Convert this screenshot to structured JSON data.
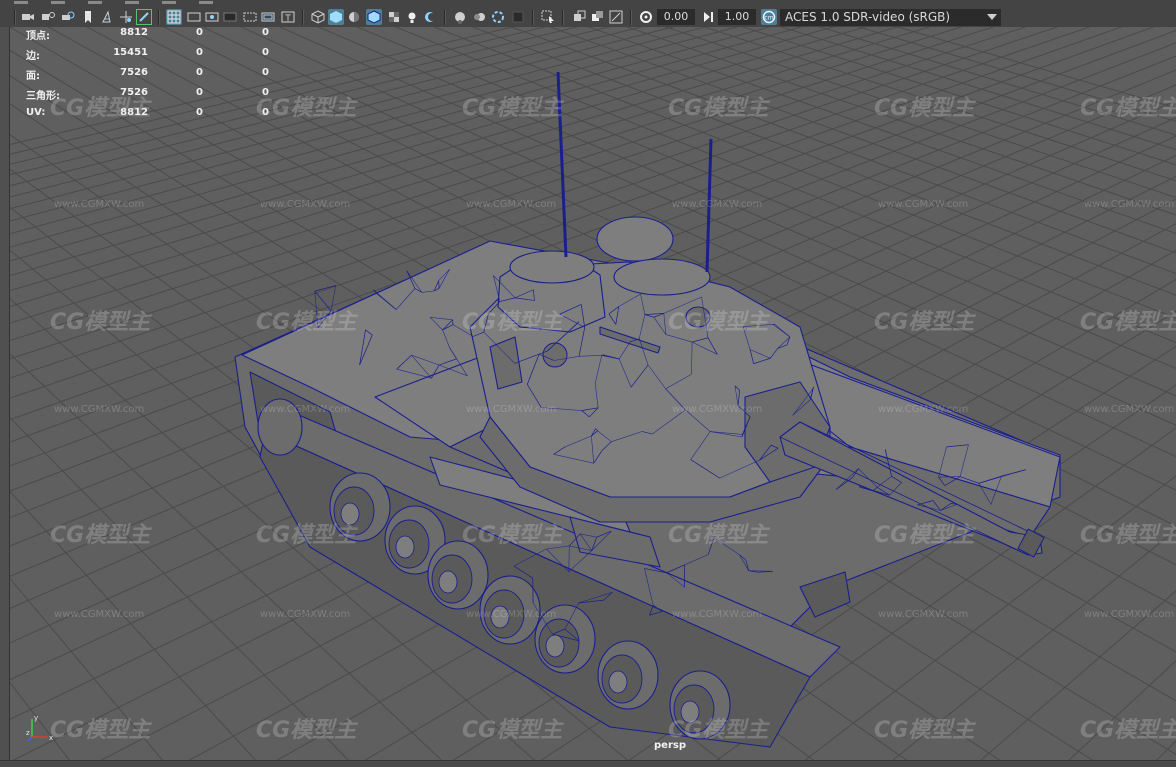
{
  "toolbar": {
    "menu_labels_clipped": [
      "",
      "",
      "",
      "",
      "",
      ""
    ],
    "exposure": "0.00",
    "gamma": "1.00",
    "color_management_icon": "color-management-icon",
    "color_space": "ACES 1.0 SDR-video (sRGB)",
    "icons": {
      "camera": "camera-icon",
      "image_plane": "image-plane-icon",
      "grid": "grid-toggle-icon",
      "wireframe": "wireframe-icon",
      "smooth_shade": "smooth-shade-icon",
      "xray": "xray-icon"
    }
  },
  "hud": {
    "rows": [
      {
        "label": "顶点:",
        "v1": "8812",
        "v2": "0",
        "v3": "0"
      },
      {
        "label": "边:",
        "v1": "15451",
        "v2": "0",
        "v3": "0"
      },
      {
        "label": "面:",
        "v1": "7526",
        "v2": "0",
        "v3": "0"
      },
      {
        "label": "三角形:",
        "v1": "7526",
        "v2": "0",
        "v3": "0"
      },
      {
        "label": "UV:",
        "v1": "8812",
        "v2": "0",
        "v3": "0"
      }
    ]
  },
  "viewport": {
    "camera": "persp",
    "axis_labels": {
      "x": "x",
      "y": "y",
      "z": "z"
    },
    "wireframe_color": "#1a1f8c",
    "background_color": "#5f5f5f"
  },
  "watermark": {
    "logo": "CG模型主",
    "url": "www.CGMXW.com"
  },
  "colors": {
    "toolbar_bg": "#444444",
    "active_button": "#4f7f94",
    "field_bg": "#2b2b2b"
  }
}
